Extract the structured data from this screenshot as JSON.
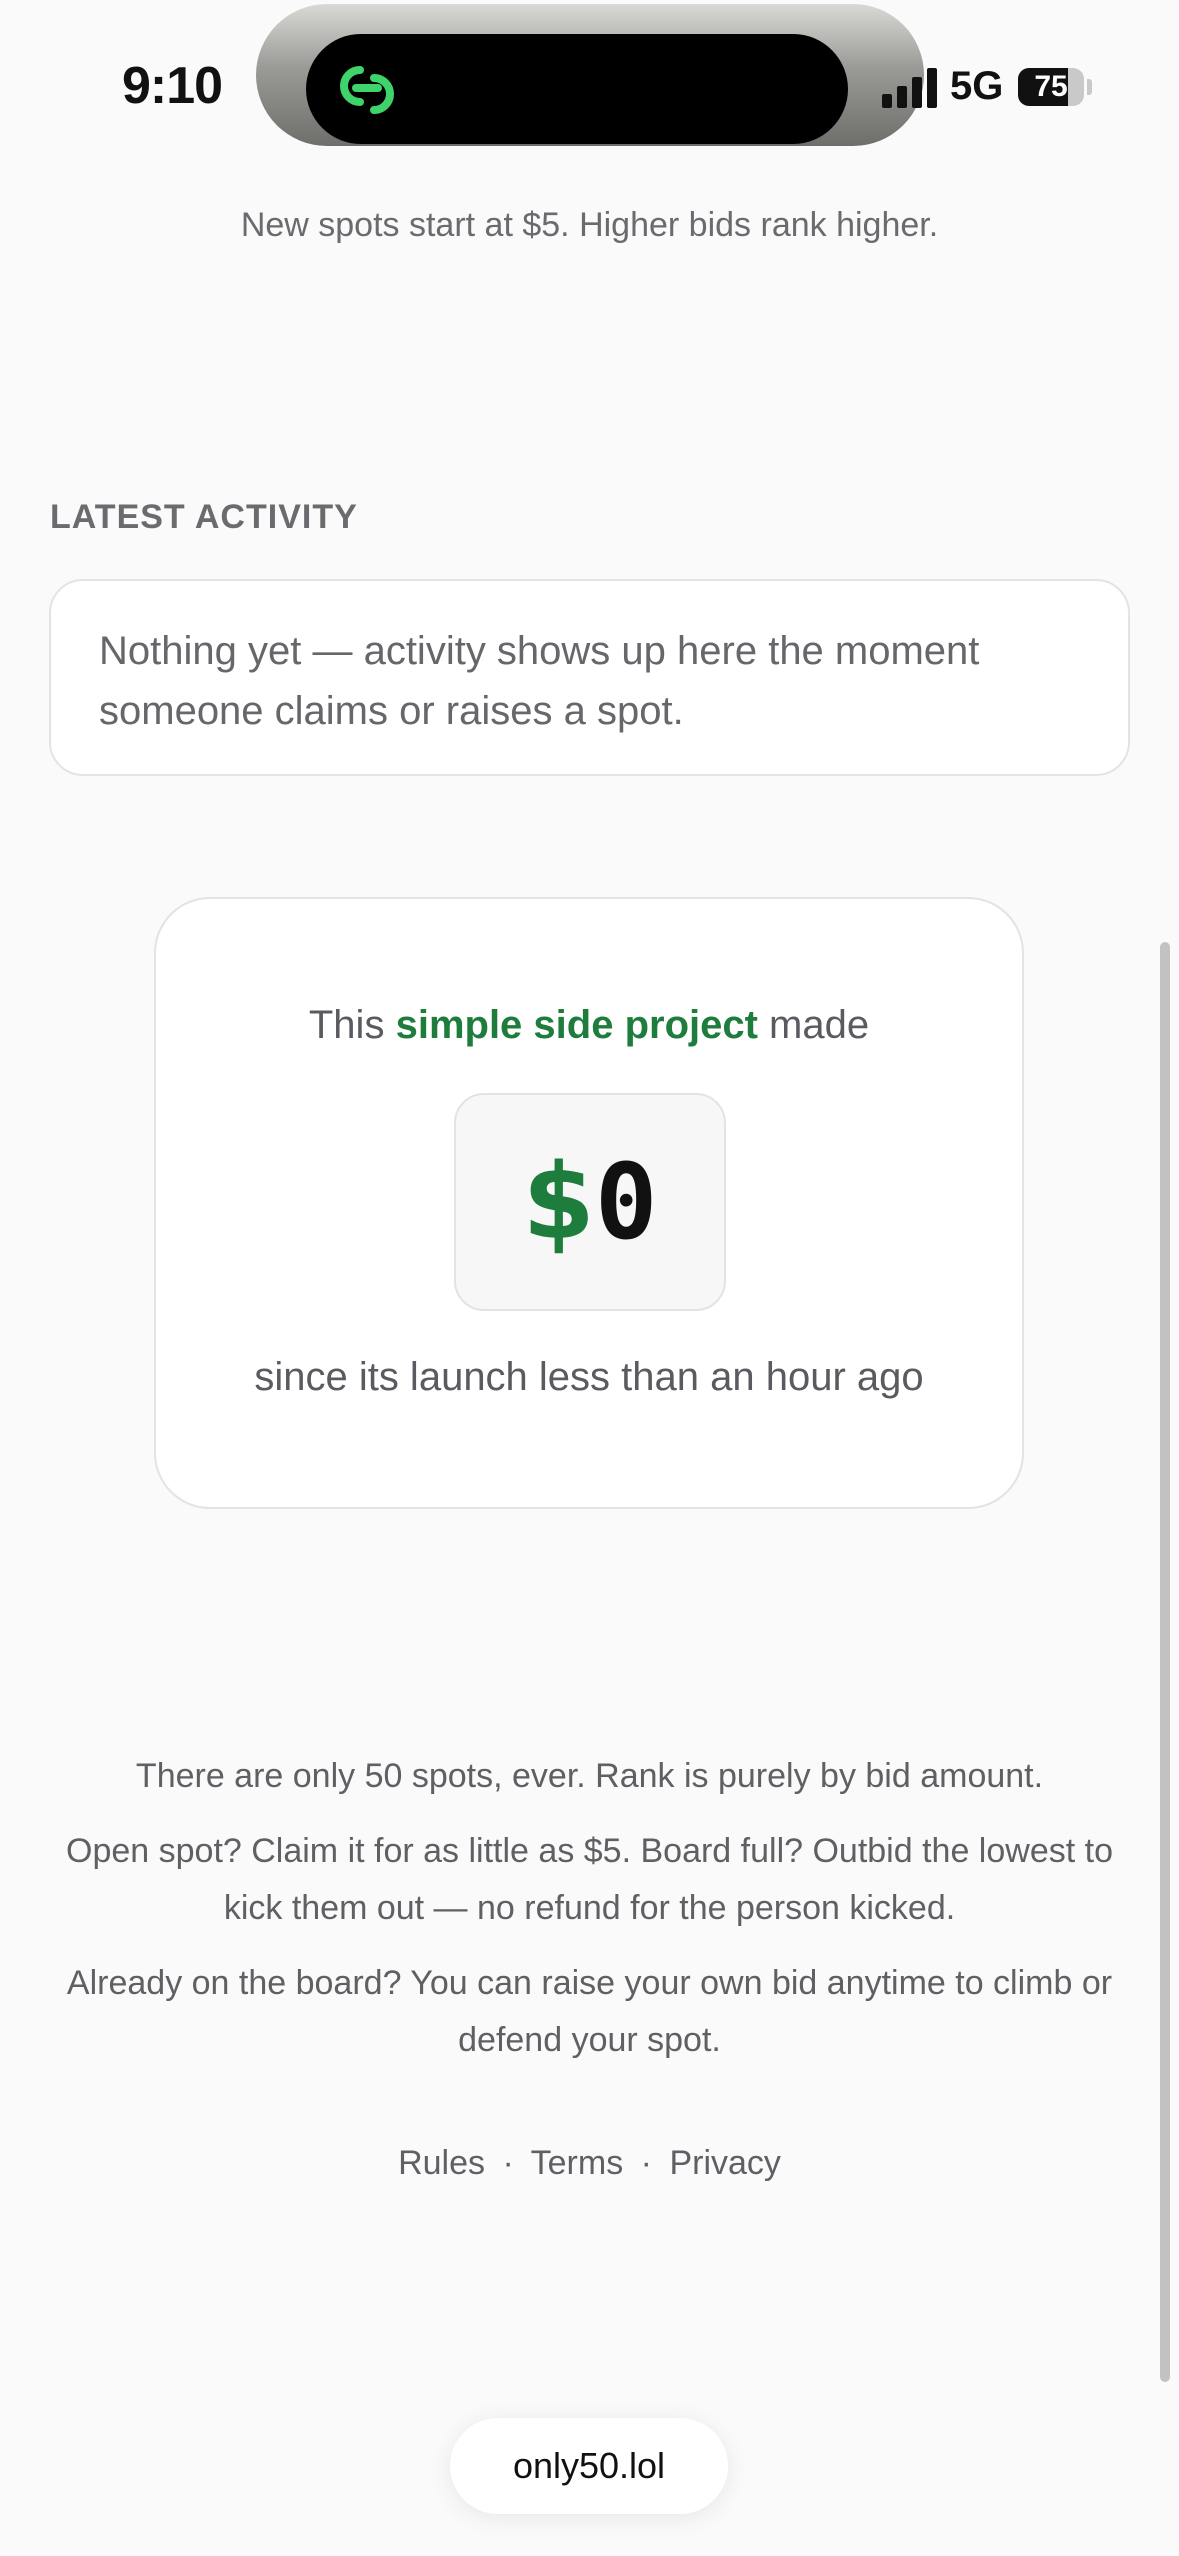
{
  "status_bar": {
    "time": "9:10",
    "network": "5G",
    "battery_level": 75,
    "island_app_icon": "link-icon",
    "island_accent": "#3fd46b"
  },
  "intro": {
    "note": "New spots start at $5. Higher bids rank higher."
  },
  "activity": {
    "heading": "LATEST ACTIVITY",
    "empty_message": "Nothing yet — activity shows up here the moment someone claims or raises a spot."
  },
  "earnings": {
    "prefix": "This",
    "link_text": "simple side project",
    "suffix": "made",
    "currency": "$",
    "amount": "0",
    "since": "since its launch less than an hour ago",
    "accent_color": "#1e7d3c"
  },
  "rules": {
    "paragraphs": [
      "There are only 50 spots, ever. Rank is purely by bid amount.",
      "Open spot? Claim it for as little as $5. Board full? Outbid the lowest to kick them out — no refund for the person kicked.",
      "Already on the board? You can raise your own bid anytime to climb or defend your spot."
    ]
  },
  "footer": {
    "links": [
      "Rules",
      "Terms",
      "Privacy"
    ],
    "separator": "·"
  },
  "browser": {
    "url": "only50.lol"
  }
}
